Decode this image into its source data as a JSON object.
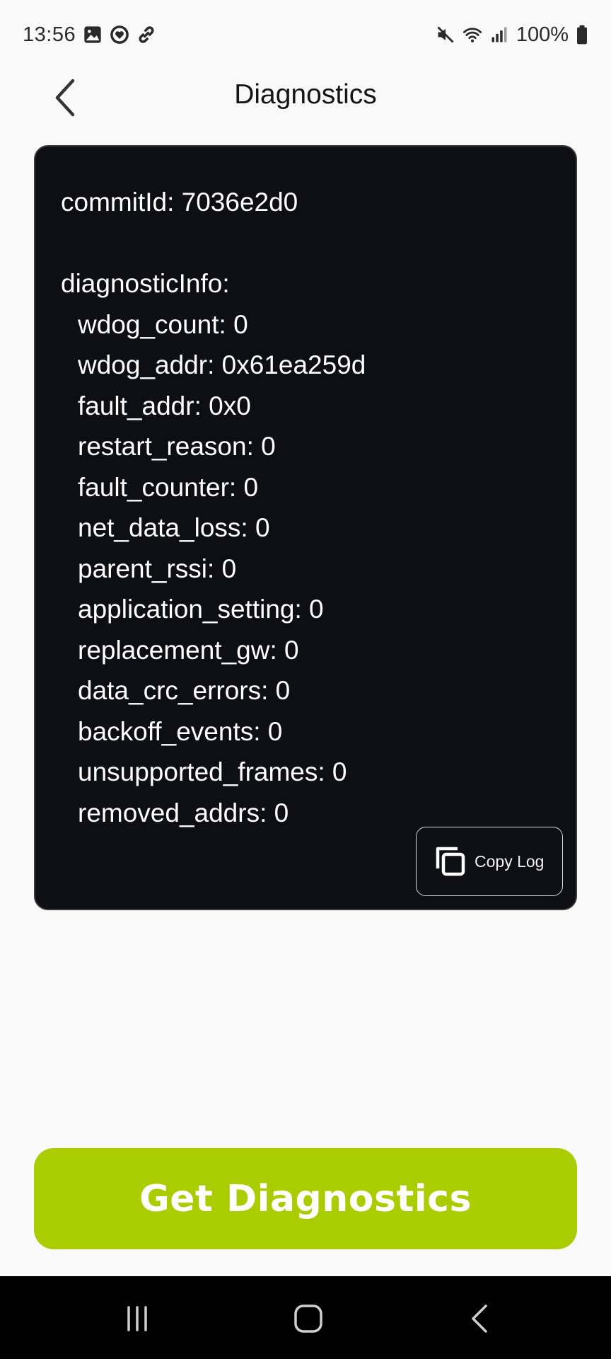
{
  "status_bar": {
    "time": "13:56",
    "left_icons": [
      "gallery-icon",
      "heart-circle-icon",
      "link-icon"
    ],
    "right_icons": [
      "mute-icon",
      "wifi-icon",
      "signal-icon",
      "battery-icon"
    ],
    "battery": "100%"
  },
  "header": {
    "back_icon": "chevron-left-icon",
    "title": "Diagnostics"
  },
  "log": {
    "commit_line": "commitId: 7036e2d0",
    "section_label": "diagnosticInfo:",
    "entries": [
      "wdog_count: 0",
      "wdog_addr: 0x61ea259d",
      "fault_addr: 0x0",
      "restart_reason: 0",
      "fault_counter: 0",
      "net_data_loss: 0",
      "parent_rssi: 0",
      "application_setting: 0",
      "replacement_gw: 0",
      "data_crc_errors: 0",
      "backoff_events: 0",
      "unsupported_frames: 0",
      "removed_addrs: 0"
    ],
    "copy_button_label": "Copy Log",
    "copy_icon": "copy-icon"
  },
  "primary_button": {
    "label": "Get Diagnostics"
  },
  "colors": {
    "background": "#f9f9f9",
    "panel": "#0e0f14",
    "accent": "#a9cd00",
    "nav_bar": "#000000"
  }
}
